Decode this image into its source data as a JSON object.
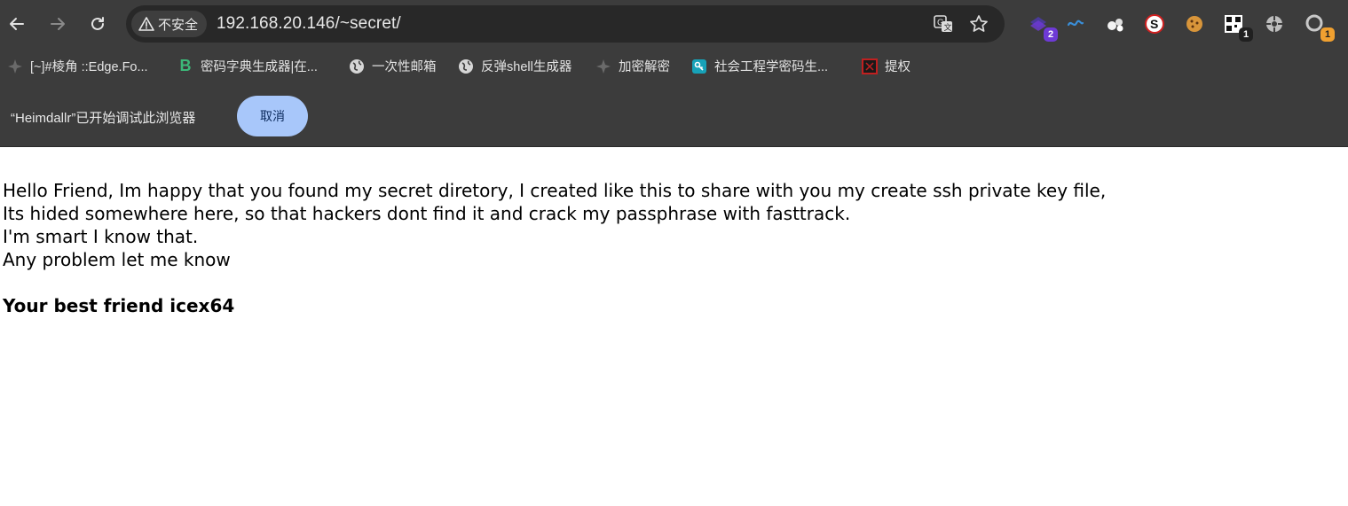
{
  "browser": {
    "url": "192.168.20.146/~secret/",
    "security_label": "不安全",
    "extensions": [
      {
        "icon": "purple-extension-icon",
        "badge": "2",
        "badge_color": "#6e3ad6"
      },
      {
        "icon": "blue-wave-extension-icon"
      },
      {
        "icon": "white-dots-extension-icon"
      },
      {
        "icon": "s-circle-extension-icon"
      },
      {
        "icon": "cookie-extension-icon"
      },
      {
        "icon": "qr-extension-icon",
        "badge": "1",
        "badge_color": "#202020"
      },
      {
        "icon": "gray-gear-extension-icon"
      },
      {
        "icon": "puzzle-extension-icon",
        "badge": "1",
        "badge_color": "#f0a030"
      }
    ]
  },
  "bookmarks": [
    {
      "label": "[~]#棱角 ::Edge.Fo...",
      "icon": "shuriken-icon"
    },
    {
      "label": "密码字典生成器|在...",
      "icon": "green-b-icon"
    },
    {
      "label": "一次性邮箱",
      "icon": "globe-icon"
    },
    {
      "label": "反弹shell生成器",
      "icon": "globe-icon"
    },
    {
      "label": "加密解密",
      "icon": "shuriken-icon"
    },
    {
      "label": "社会工程学密码生...",
      "icon": "key-icon"
    },
    {
      "label": "提权",
      "icon": "red-box-icon"
    }
  ],
  "infobar": {
    "message": "“Heimdallr”已开始调试此浏览器",
    "cancel_label": "取消"
  },
  "page": {
    "lines": [
      "Hello Friend, Im happy that you found my secret diretory, I created like this to share with you my create ssh private key file,",
      "Its hided somewhere here, so that hackers dont find it and crack my passphrase with fasttrack.",
      "I'm smart I know that.",
      "Any problem let me know"
    ],
    "signature": "Your best friend icex64"
  },
  "colors": {
    "chrome_bg": "#3c3c3c",
    "omnibox_bg": "#282828",
    "cancel_button_bg": "#a8c7fa",
    "page_bg": "#ffffff"
  }
}
